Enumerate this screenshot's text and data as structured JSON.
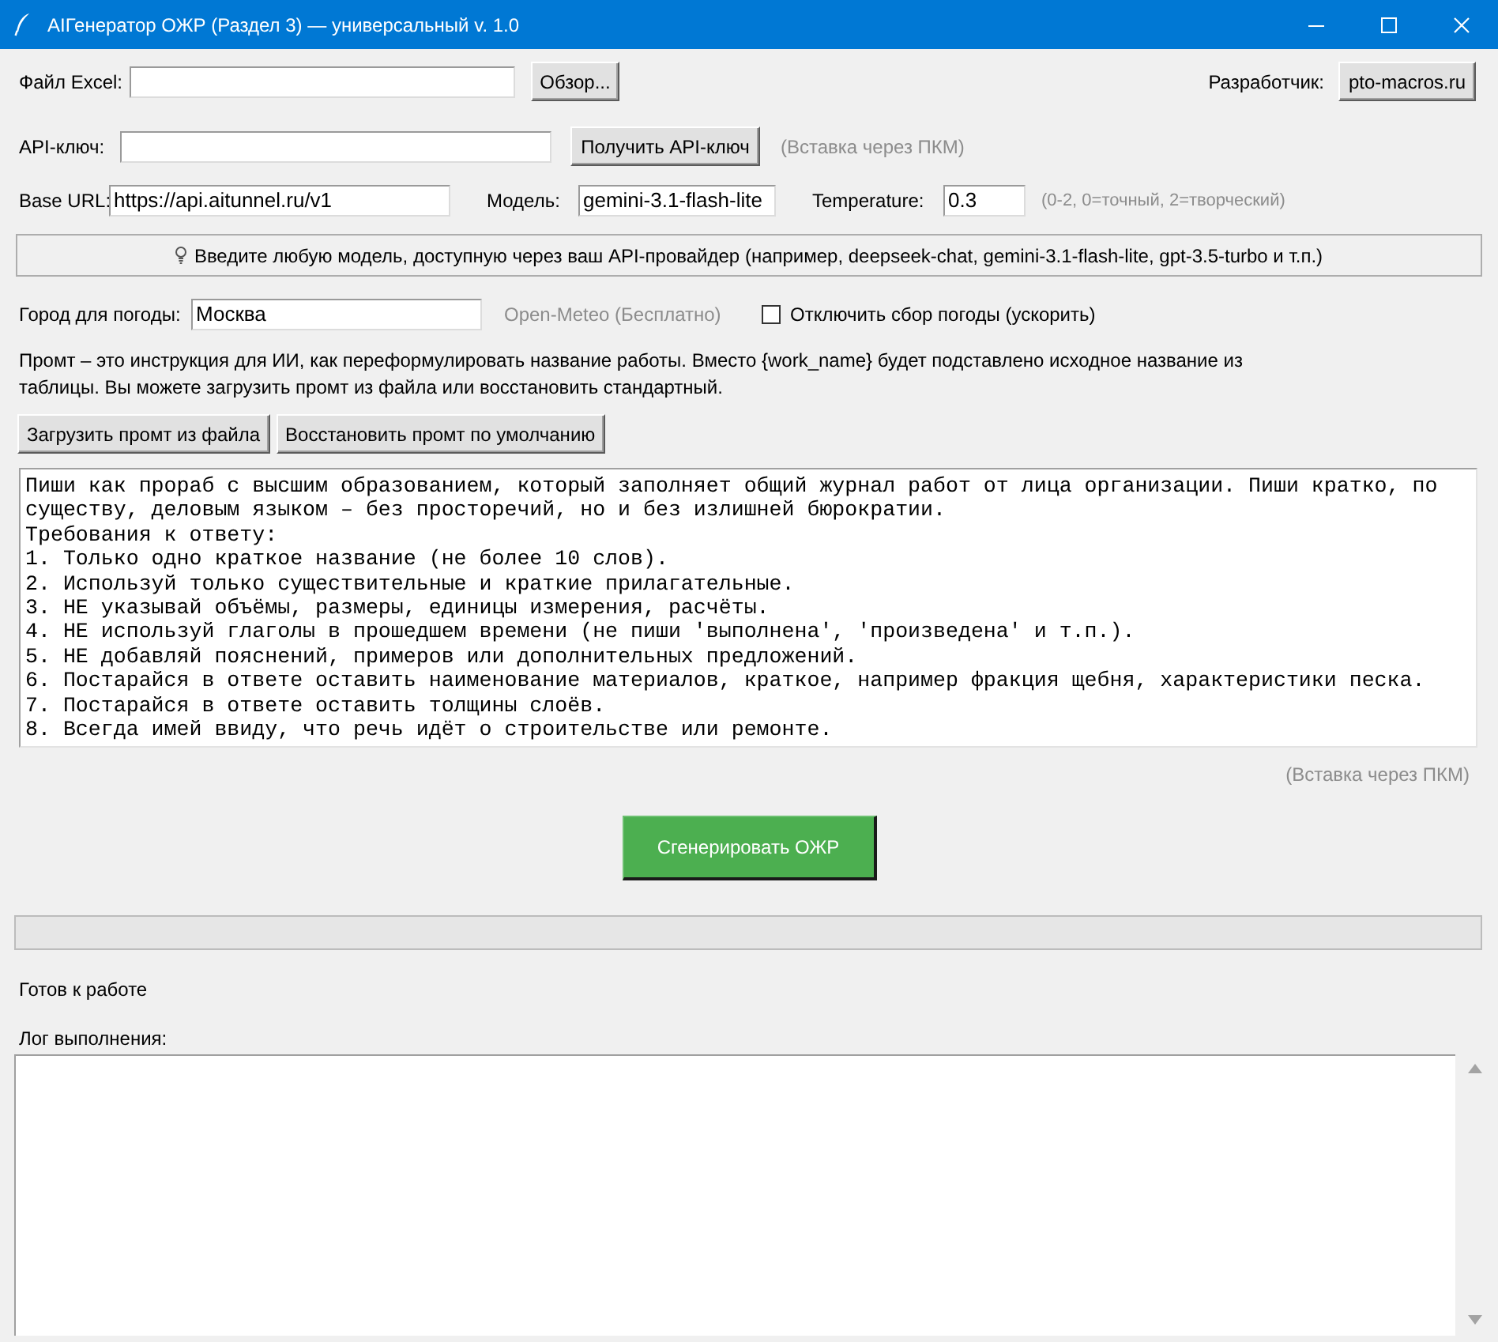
{
  "window": {
    "title": "AIГенератор ОЖР (Раздел 3) — универсальный v. 1.0"
  },
  "file": {
    "label": "Файл Excel:",
    "browse_button": "Обзор..."
  },
  "developer": {
    "label": "Разработчик:",
    "link_button": "pto-macros.ru"
  },
  "api_key": {
    "label": "API-ключ:",
    "get_key_button": "Получить API-ключ",
    "hint": "(Вставка через ПКМ)"
  },
  "settings": [
    {
      "label": "Base URL:",
      "value": "https://api.aitunnel.ru/v1"
    },
    {
      "label": "Модель:",
      "value": "gemini-3.1-flash-lite"
    },
    {
      "label": "Temperature:",
      "value": "0.3"
    }
  ],
  "temperature_hint": "(0-2, 0=точный, 2=творческий)",
  "info_bar": {
    "text": "Введите любую модель, доступную через ваш API-провайдер (например, deepseek-chat, gemini-3.1-flash-lite, gpt-3.5-turbo и т.п.)"
  },
  "weather": {
    "label": "Город для погоды:",
    "value": "Москва",
    "source": "Open-Meteo (Бесплатно)",
    "disable_checkbox": {
      "label": "Отключить сбор погоды (ускорить)",
      "checked": false
    }
  },
  "prompt": {
    "description": "Промт – это инструкция для ИИ, как переформулировать название работы. Вместо {work_name} будет подставлено исходное название из таблицы. Вы можете загрузить промт из файла или восстановить стандартный.",
    "buttons": [
      "Загрузить промт из файла",
      "Восстановить промт по умолчанию"
    ],
    "text": "Пиши как прораб с высшим образованием, который заполняет общий журнал работ от лица организации. Пиши кратко, по существу, деловым языком – без просторечий, но и без излишней бюрократии.\nТребования к ответу:\n1. Только одно краткое название (не более 10 слов).\n2. Используй только существительные и краткие прилагательные.\n3. НЕ указывай объёмы, размеры, единицы измерения, расчёты.\n4. НЕ используй глаголы в прошедшем времени (не пиши 'выполнена', 'произведена' и т.п.).\n5. НЕ добавляй пояснений, примеров или дополнительных предложений.\n6. Постарайся в ответе оставить наименование материалов, краткое, например фракция щебня, характеристики песка.\n7. Постарайся в ответе оставить толщины слоёв.\n8. Всегда имей ввиду, что речь идёт о строительстве или ремонте.",
    "hint": "(Вставка через ПКМ)"
  },
  "generate_button": "Сгенерировать ОЖР",
  "progress": {
    "level": 0
  },
  "status": "Готов к работе",
  "log": {
    "label": "Лог выполнения:"
  }
}
